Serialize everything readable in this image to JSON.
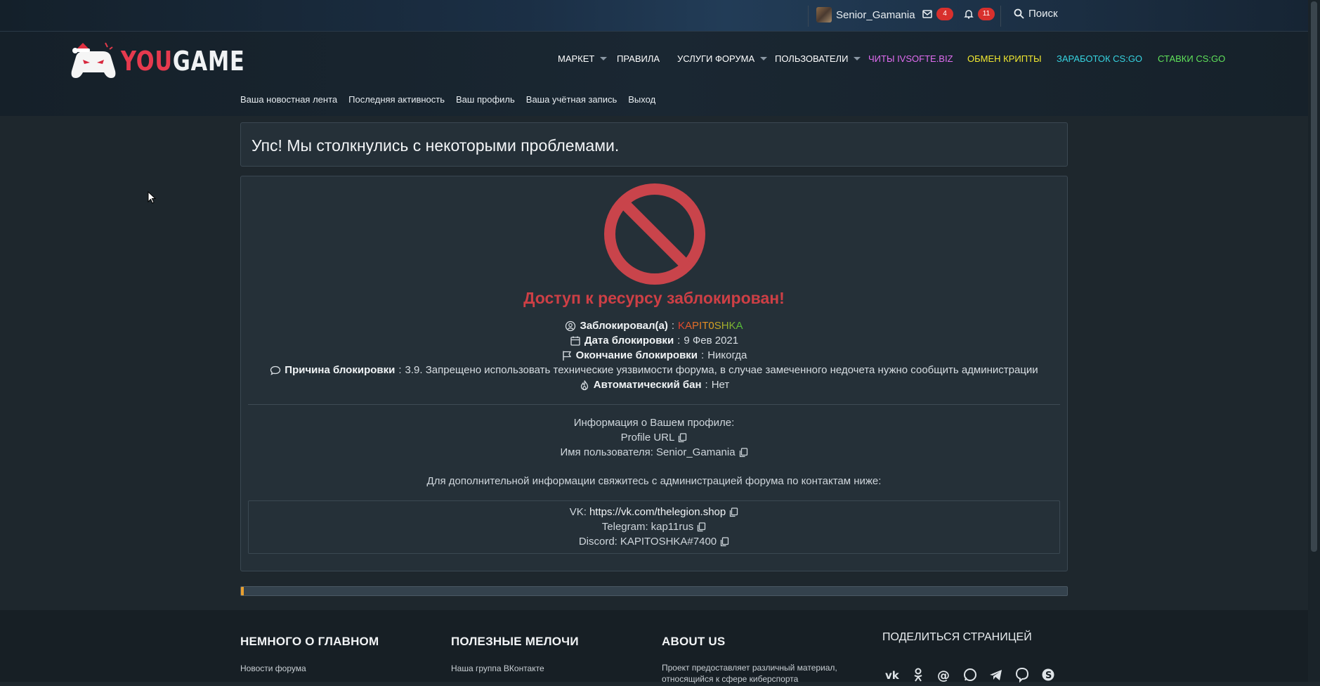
{
  "topbar": {
    "username": "Senior_Gamania",
    "messages_count": "4",
    "alerts_count": "11",
    "search_label": "Поиск"
  },
  "logo": {
    "part1": "YOU",
    "part2": "GAME"
  },
  "nav": {
    "items": [
      {
        "label": "МАРКЕТ",
        "color": "#ffffff"
      },
      {
        "label": "ПРАВИЛА",
        "color": "#ffffff"
      },
      {
        "label": "УСЛУГИ ФОРУМА",
        "color": "#ffffff"
      },
      {
        "label": "ПОЛЬЗОВАТЕЛИ",
        "color": "#ffffff"
      },
      {
        "label": "ЧИТЫ IVSOFTE.BIZ",
        "color": "#e06cf0"
      },
      {
        "label": "ОБМЕН КРИПТЫ",
        "color": "#f2e930"
      },
      {
        "label": "ЗАРАБОТОК CS:GO",
        "color": "#36d3e0"
      },
      {
        "label": "СТАВКИ CS:GO",
        "color": "#5fe15a"
      }
    ]
  },
  "subnav": {
    "items": [
      "Ваша новостная лента",
      "Последняя активность",
      "Ваш профиль",
      "Ваша учётная запись",
      "Выход"
    ]
  },
  "notice": {
    "title": "Упс! Мы столкнулись с некоторыми проблемами."
  },
  "ban": {
    "title": "Доступ к ресурсу заблокирован!",
    "blocked_by_label": "Заблокировал(а)",
    "blocked_by": "KAPIT0SHKA",
    "date_label": "Дата блокировки",
    "date": "9 Фев 2021",
    "end_label": "Окончание блокировки",
    "end": "Никогда",
    "reason_label": "Причина блокировки",
    "reason": "3.9. Запрещено использовать технические уязвимости форума, в случае замеченного недочета нужно сообщить администрации",
    "auto_label": "Автоматический бан",
    "auto": "Нет"
  },
  "profile": {
    "heading": "Информация о Вашем профиле:",
    "url_label": "Profile URL",
    "username_label": "Имя пользователя:",
    "username": "Senior_Gamania"
  },
  "contact_note": "Для дополнительной информации свяжитесь с администрацией форума по контактам ниже:",
  "contacts": {
    "vk_label": "VK:",
    "vk": "https://vk.com/thelegion.shop",
    "telegram_label": "Telegram:",
    "telegram": "kap11rus",
    "discord_label": "Discord:",
    "discord": "KAPITOSHKA#7400"
  },
  "progress": {
    "fraction": 0.003
  },
  "footer": {
    "col1_title": "НЕМНОГО О ГЛАВНОМ",
    "col1_link": "Новости форума",
    "col2_title": "ПОЛЕЗНЫЕ МЕЛОЧИ",
    "col2_link": "Наша группа ВКонтакте",
    "col3_title": "ABOUT US",
    "col3_text": "Проект предоставляет различный материал, относящийся к сфере киберспорта",
    "share_title": "ПОДЕЛИТЬСЯ СТРАНИЦЕЙ",
    "socials": [
      "vk-icon",
      "odnoklassniki-icon",
      "email-icon",
      "whatsapp-icon",
      "telegram-icon",
      "viber-icon",
      "skype-icon"
    ]
  }
}
